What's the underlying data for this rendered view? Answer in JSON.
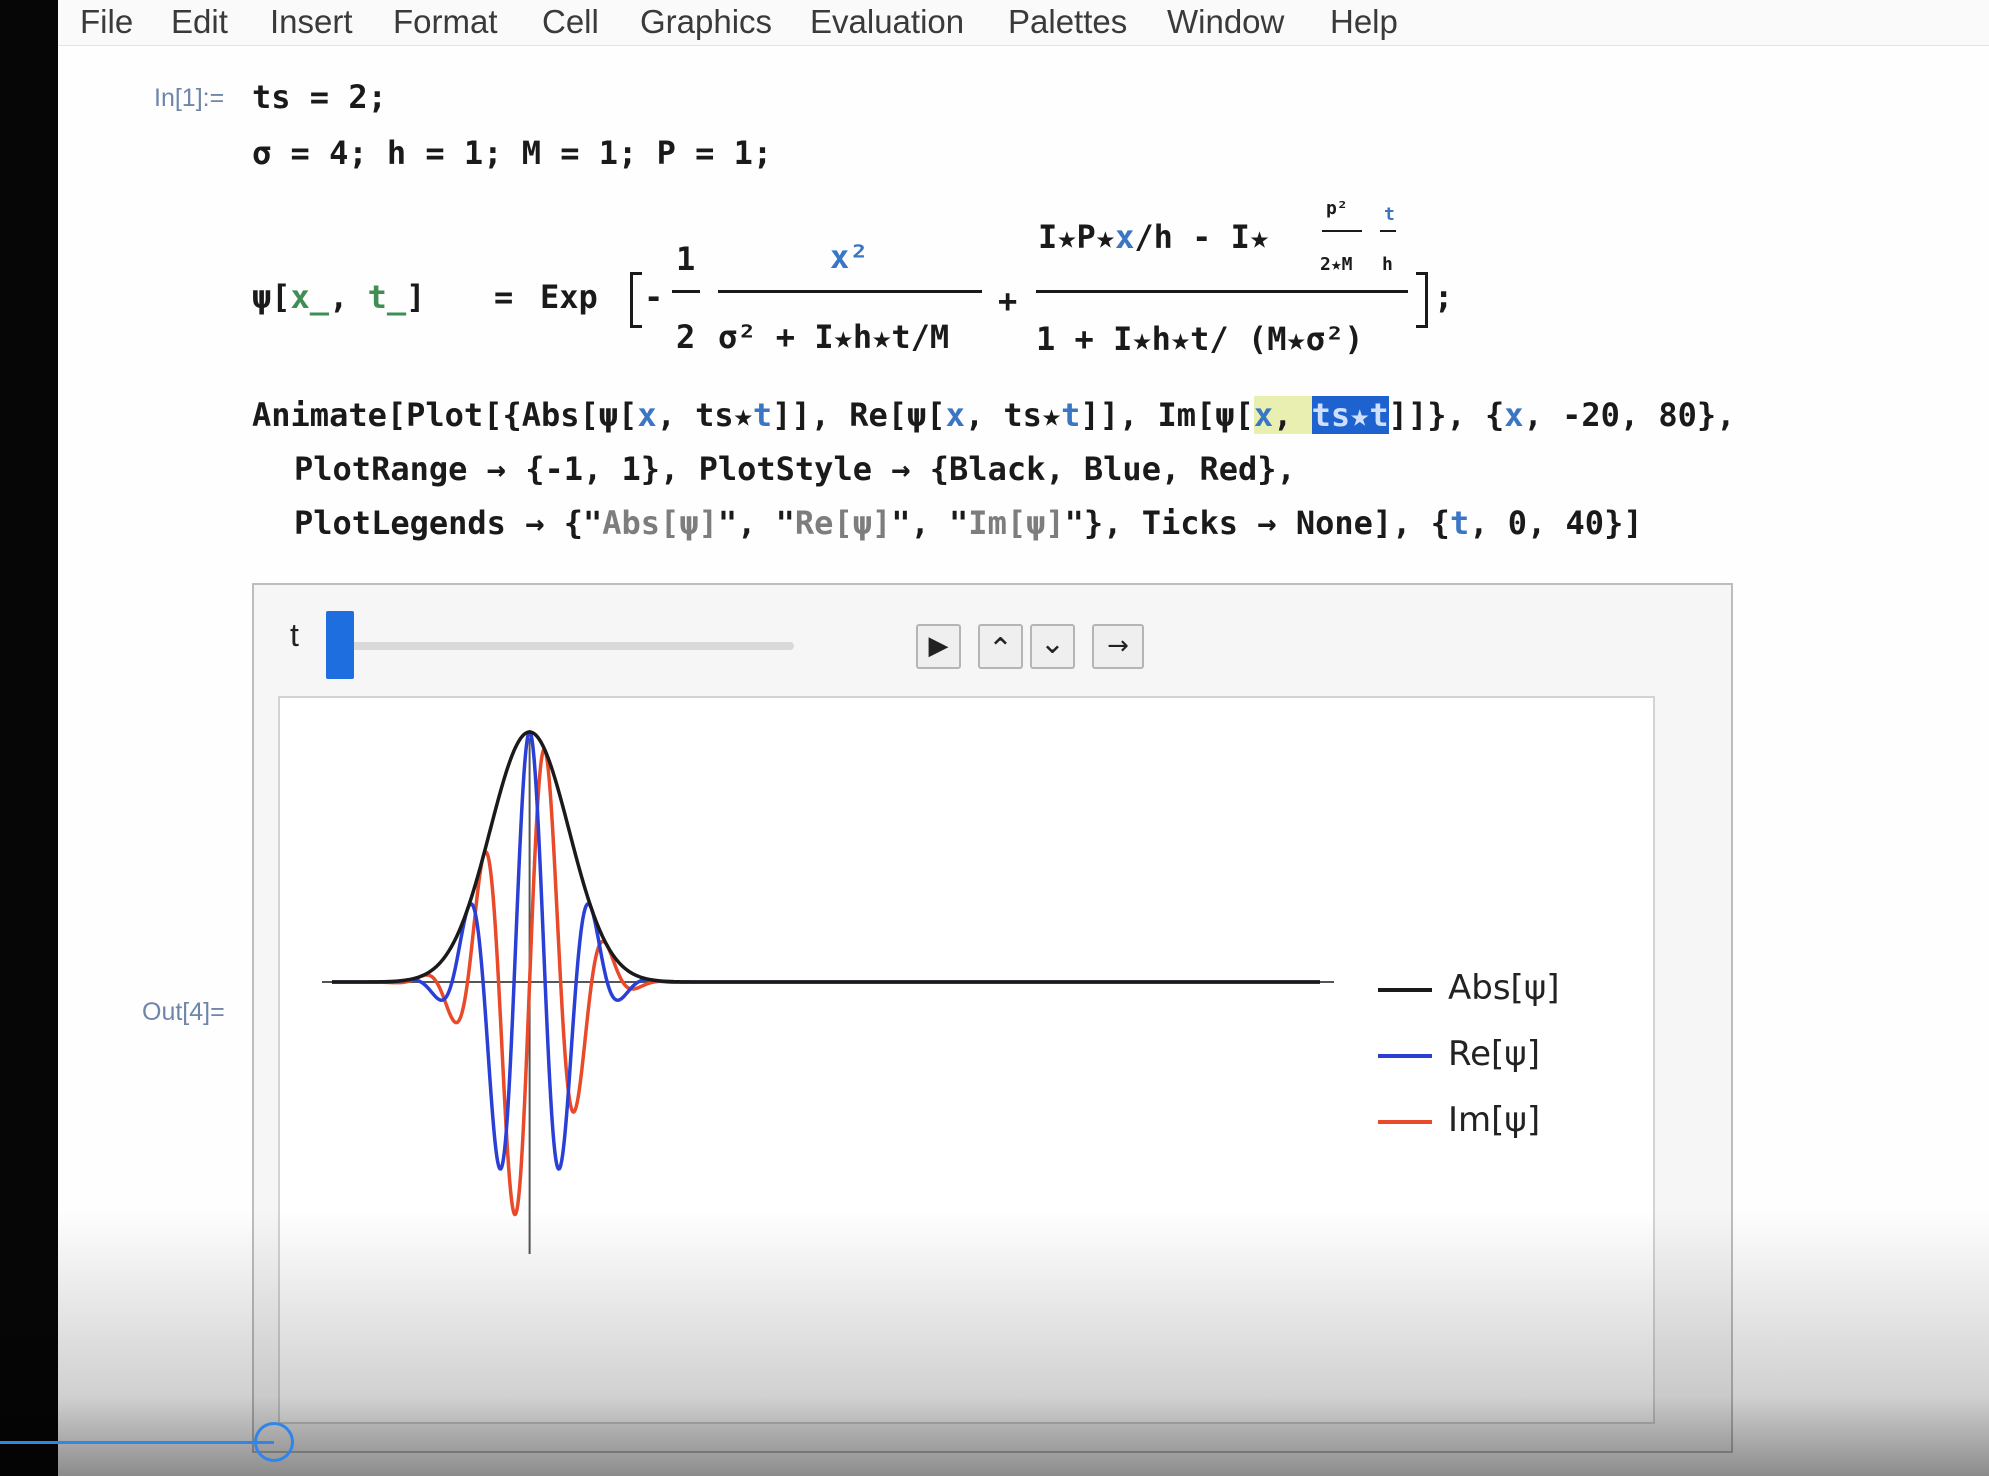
{
  "menu": [
    "File",
    "Edit",
    "Insert",
    "Format",
    "Cell",
    "Graphics",
    "Evaluation",
    "Palettes",
    "Window",
    "Help"
  ],
  "cell_in_label": "In[1]:=",
  "cell_out_label": "Out[4]=",
  "code": {
    "line1": "ts = 2;",
    "line2": "σ = 4; h = 1; M = 1; P = 1;",
    "psi_def": {
      "lhs_func": "ψ[",
      "lhs_x": "x_",
      "lhs_sep": ", ",
      "lhs_t": "t_",
      "lhs_close": "]",
      "eq": "=",
      "exp": "Exp",
      "minus": "-",
      "half_num": "1",
      "half_den": "2",
      "f1_num": "x²",
      "f1_den": "σ² + I★h★t/M",
      "plus": "+",
      "f2_num_pre": "I★P★",
      "f2_num_x": "x",
      "f2_num_post": "/h - I★",
      "f2_p2": "p²",
      "f2_2M": "2★M",
      "f2_t": "t",
      "f2_h": "h",
      "f2_den": "1 + I★h★t/ (M★σ²)",
      "end": ";"
    },
    "anim1_a": "Animate[Plot[{Abs[ψ[",
    "anim1_b": "x",
    "anim1_c": ", ts★",
    "anim1_d": "t",
    "anim1_e": "]], Re[ψ[",
    "anim1_f": "x",
    "anim1_g": ", ts★",
    "anim1_h": "t",
    "anim1_i": "]], Im[ψ[",
    "anim1_j": "x",
    "anim1_k": ", ",
    "anim1_sel": "ts★t",
    "anim1_l": "]]}, {",
    "anim1_m": "x",
    "anim1_n": ", -20, 80},",
    "anim2": "PlotRange → {-1, 1}, PlotStyle → {Black, Blue, Red},",
    "anim3_a": "PlotLegends → {\"",
    "anim3_b": "Abs[ψ]",
    "anim3_c": "\", \"",
    "anim3_d": "Re[ψ]",
    "anim3_e": "\", \"",
    "anim3_f": "Im[ψ]",
    "anim3_g": "\"}, Ticks → None], {",
    "anim3_h": "t",
    "anim3_i": ", 0, 40}]"
  },
  "animator": {
    "var_label": "t",
    "t_value": 0,
    "t_range": [
      0,
      40
    ],
    "buttons": {
      "play": "▶",
      "faster": "⌃",
      "slower": "⌄",
      "direction": "→"
    },
    "button_icons": [
      "play-icon",
      "faster-icon",
      "slower-icon",
      "direction-arrow-icon"
    ]
  },
  "chart_data": {
    "type": "line",
    "title": "",
    "xlabel": "",
    "ylabel": "",
    "xlim": [
      -20,
      80
    ],
    "ylim": [
      -1,
      1
    ],
    "ticks": "none",
    "legend_position": "right",
    "series": [
      {
        "name": "Abs[ψ]",
        "color": "#1a1a1a",
        "function": "abs"
      },
      {
        "name": "Re[ψ]",
        "color": "#2a3fd6",
        "function": "re"
      },
      {
        "name": "Im[ψ]",
        "color": "#e84a2a",
        "function": "im"
      }
    ],
    "params": {
      "ts": 2,
      "sigma": 4,
      "h": 1,
      "M": 1,
      "P": 1,
      "t": 0
    }
  }
}
